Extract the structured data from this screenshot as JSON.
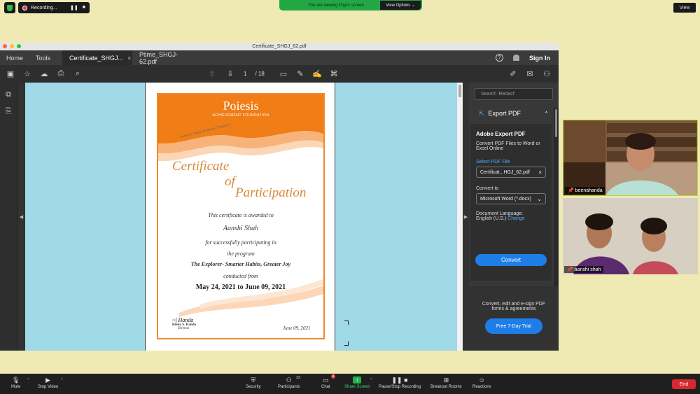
{
  "zoom": {
    "recording_label": "Recording...",
    "viewing_text": "You are viewing Puja's screen",
    "view_options": "View Options ⌄",
    "view_button": "View",
    "end_label": "End",
    "controls": [
      {
        "label": "Mute",
        "icon": "microphone-icon"
      },
      {
        "label": "Stop Video",
        "icon": "video-camera-icon"
      },
      {
        "label": "Security",
        "icon": "shield-icon"
      },
      {
        "label": "Participants",
        "icon": "participants-icon",
        "count": "23"
      },
      {
        "label": "Chat",
        "icon": "chat-icon",
        "badge": "4"
      },
      {
        "label": "Share Screen",
        "icon": "share-screen-icon"
      },
      {
        "label": "Pause/Stop Recording",
        "icon": "pause-recording-icon"
      },
      {
        "label": "Breakout Rooms",
        "icon": "breakout-rooms-icon"
      },
      {
        "label": "Reactions",
        "icon": "reactions-icon"
      }
    ],
    "participants": [
      {
        "name": "beenahanda"
      },
      {
        "name": "aanshi shah"
      }
    ]
  },
  "acrobat": {
    "window_title": "Certificate_SHGJ_62.pdf",
    "nav_home": "Home",
    "nav_tools": "Tools",
    "tabs": [
      {
        "label": "Certificate_SHGJ...",
        "active": true
      },
      {
        "label": "Ptime_SHGJ-62.pdf",
        "active": false
      }
    ],
    "sign_in": "Sign In",
    "page_current": "1",
    "page_total": "/ 18",
    "right_panel": {
      "search_placeholder": "Search 'Redact'",
      "export_title": "Export PDF",
      "card_heading": "Adobe Export PDF",
      "card_desc": "Convert PDF Files to Word or Excel Online",
      "select_label": "Select PDF File",
      "file_value": "Certificat...HGJ_62.pdf",
      "convert_to_label": "Convert to",
      "convert_to_value": "Microsoft Word (*.docx)",
      "doc_lang_label": "Document Language:",
      "doc_lang_value": "English (U.S.)",
      "change_link": "Change",
      "convert_button": "Convert",
      "promo_text": "Convert, edit and e-sign PDF forms & agreements",
      "trial_button": "Free 7-Day Trial"
    }
  },
  "certificate": {
    "org_name": "Poiesis",
    "org_sub": "ACHIEVEMENT FOUNDATION",
    "tagline": "Learners Today, Achievers Tomorrow",
    "title_1": "Certificate",
    "title_2": "of",
    "title_3": "Participation",
    "line_awarded": "This certificate is awarded to",
    "recipient": "Aanshi Shah",
    "line_participating": "for successfully participating in",
    "line_program": "the program",
    "program_name": "The Explorer- Smarter Habits, Greater Joy",
    "line_conducted": "conducted from",
    "dates": "May 24, 2021 to June 09, 2021",
    "signatory_name": "Beena S. Handa",
    "signatory_title": "Director",
    "issue_date": "June 09, 2021"
  }
}
